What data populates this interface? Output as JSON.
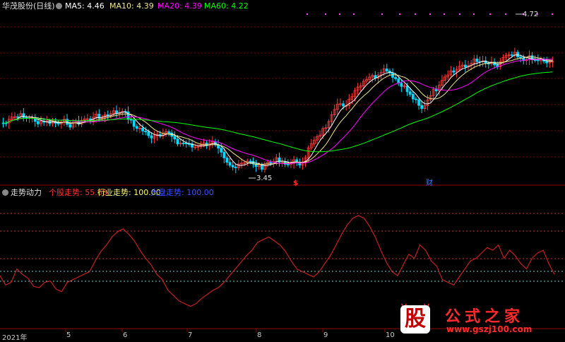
{
  "main_panel": {
    "title": "华茂股份(日线)",
    "ma": [
      {
        "label": "MA5: 4.46",
        "color": "#ffffff"
      },
      {
        "label": "MA10: 4.39",
        "color": "#f0e68c"
      },
      {
        "label": "MA20: 4.39",
        "color": "#ff00ff"
      },
      {
        "label": "MA60: 4.22",
        "color": "#00ff00"
      }
    ],
    "high_label": "4.72",
    "low_label": "3.45",
    "markers": [
      {
        "text": "$",
        "color": "#ff3030"
      },
      {
        "text": "财",
        "color": "#3a7bff"
      }
    ]
  },
  "indicator_panel": {
    "title": "走势动力",
    "stock_trend": "个股走势: 55.68",
    "industry_trend": "行业走势: 100.00",
    "market_trend": "大盘走势: 100.00"
  },
  "date_axis": [
    "2021年",
    "5",
    "6",
    "7",
    "8",
    "9",
    "10"
  ],
  "watermark": {
    "logo_char": "股",
    "brand": "公式之家",
    "url": "www.gszj100.com"
  },
  "colors": {
    "up": "#ff3c3c",
    "down": "#00d8ff",
    "grid": "#8b0000",
    "line": "#c42020",
    "bg": "#000000"
  },
  "chart_data": {
    "type": "line",
    "title": "走势动力",
    "x": [
      1,
      2,
      3,
      4,
      5,
      6,
      7,
      8,
      9,
      10,
      11,
      12,
      13,
      14,
      15,
      16,
      17,
      18,
      19,
      20,
      21,
      22,
      23,
      24,
      25,
      26,
      27,
      28,
      29,
      30,
      31,
      32,
      33,
      34,
      35,
      36,
      37,
      38,
      39,
      40,
      41,
      42,
      43,
      44,
      45,
      46,
      47,
      48,
      49,
      50,
      51,
      52,
      53,
      54,
      55,
      56,
      57,
      58,
      59,
      60,
      61,
      62,
      63,
      64,
      65,
      66,
      67,
      68,
      69,
      70,
      71,
      72,
      73,
      74,
      75,
      76,
      77,
      78,
      79,
      80,
      81,
      82,
      83,
      84,
      85,
      86,
      87,
      88,
      89,
      90,
      91,
      92,
      93,
      94,
      95,
      96,
      97,
      98,
      99,
      100
    ],
    "series": [
      {
        "name": "个股走势",
        "values": [
          57,
          50,
          52,
          62,
          58,
          55,
          49,
          48,
          52,
          53,
          47,
          45,
          52,
          54,
          56,
          58,
          60,
          68,
          75,
          80,
          86,
          90,
          92,
          88,
          83,
          76,
          70,
          65,
          58,
          54,
          46,
          42,
          38,
          36,
          34,
          36,
          40,
          43,
          46,
          48,
          52,
          57,
          62,
          67,
          72,
          76,
          82,
          84,
          86,
          83,
          80,
          75,
          68,
          62,
          60,
          58,
          56,
          60,
          66,
          72,
          80,
          88,
          95,
          100,
          102,
          100,
          94,
          86,
          76,
          67,
          60,
          57,
          65,
          73,
          70,
          80,
          76,
          68,
          64,
          54,
          52,
          50,
          56,
          62,
          68,
          70,
          74,
          78,
          76,
          80,
          70,
          76,
          72,
          66,
          62,
          70,
          74,
          76,
          66,
          58
        ]
      }
    ],
    "ylim": [
      20,
      110
    ],
    "ref_lines": [
      50,
      75
    ]
  }
}
